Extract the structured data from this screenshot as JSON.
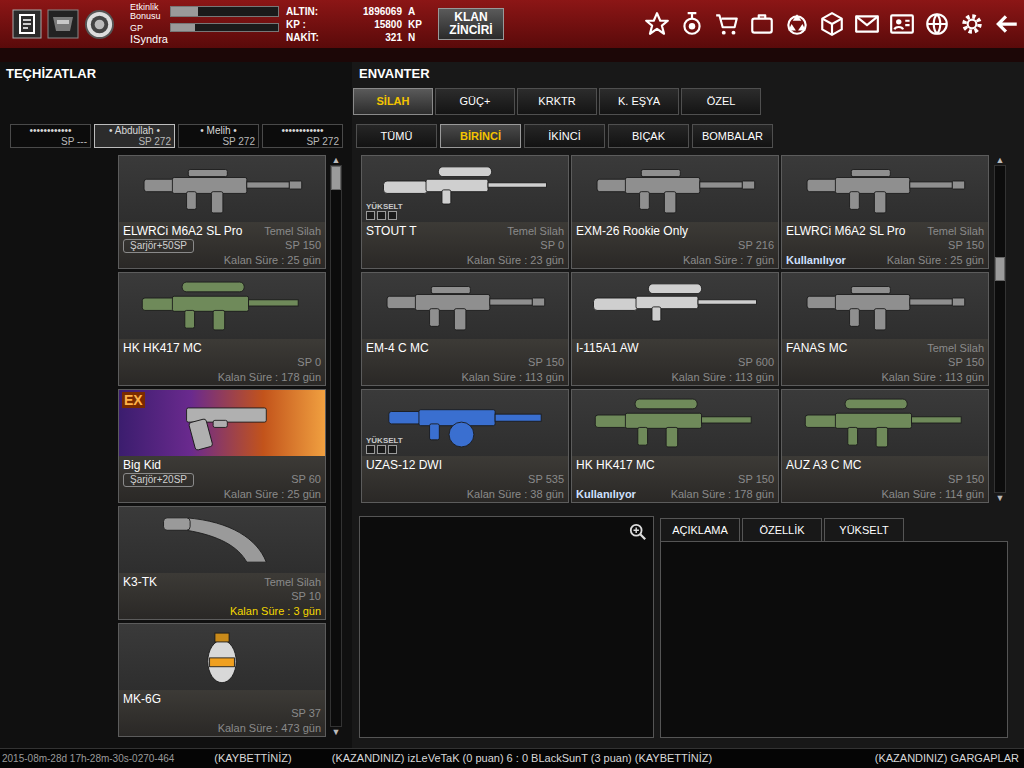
{
  "header": {
    "bonus_label": [
      "Etkinlik",
      "Bonusu"
    ],
    "bonus_level": 0.25,
    "gp_label": "GP",
    "gp_level": 0.22,
    "player": "ISyndra",
    "currencies": [
      {
        "label": "ALTIN:",
        "value": "1896069",
        "unit": "A"
      },
      {
        "label": "KP :",
        "value": "15800",
        "unit": "KP"
      },
      {
        "label": "NAKİT:",
        "value": "321",
        "unit": "N"
      }
    ],
    "clan_button": [
      "KLAN",
      "ZİNCİRİ"
    ]
  },
  "equipment": {
    "title": "TEÇHİZATLAR",
    "characters": [
      {
        "name": "••••••••••••",
        "sp": "SP ---",
        "selected": false
      },
      {
        "name": "• Abdullah •",
        "sp": "SP 272",
        "selected": true
      },
      {
        "name": "• Melih •",
        "sp": "SP 272",
        "selected": false
      },
      {
        "name": "••••••••••••",
        "sp": "SP 272",
        "selected": false
      }
    ],
    "items": [
      {
        "kind": "rifle",
        "name": "ELWRCi M6A2 SL Pro",
        "class": "Temel Silah",
        "addon": "Şarjör+50SP",
        "sp": "SP 150",
        "remaining": "Kalan Süre : 25 gün",
        "expiring": false
      },
      {
        "kind": "marksman",
        "name": "HK HK417 MC",
        "sp": "SP 0",
        "remaining": "Kalan Süre : 178 gün",
        "expiring": false
      },
      {
        "kind": "pistol",
        "name": "Big Kid",
        "badge": "EX",
        "addon": "Şarjör+20SP",
        "sp": "SP 60",
        "remaining": "Kalan Süre : 25 gün",
        "expiring": false
      },
      {
        "kind": "knife",
        "name": "K3-TK",
        "class": "Temel Silah",
        "sp": "SP 10",
        "remaining": "Kalan Süre : 3 gün",
        "expiring": true
      },
      {
        "kind": "grenade",
        "name": "MK-6G",
        "sp": "SP 37",
        "remaining": "Kalan Süre : 473 gün",
        "expiring": false
      }
    ],
    "scrollbar": {
      "up": "▲",
      "down": "▼",
      "position": 0
    }
  },
  "inventory": {
    "title": "ENVANTER",
    "categories": [
      {
        "label": "SİLAH",
        "selected": true
      },
      {
        "label": "GÜÇ+",
        "selected": false
      },
      {
        "label": "KRKTR",
        "selected": false
      },
      {
        "label": "K. EŞYA",
        "selected": false
      },
      {
        "label": "ÖZEL",
        "selected": false
      }
    ],
    "subcategories": [
      {
        "label": "TÜMÜ",
        "selected": false
      },
      {
        "label": "BİRİNCİ",
        "selected": true
      },
      {
        "label": "İKİNCİ",
        "selected": false
      },
      {
        "label": "BIÇAK",
        "selected": false
      },
      {
        "label": "BOMBALAR",
        "selected": false
      }
    ],
    "items": [
      {
        "kind": "sniper",
        "name": "STOUT T",
        "class": "Temel Silah",
        "sp": "SP 0",
        "remaining": "Kalan Süre : 23 gün",
        "expiring": false,
        "upgrade": {
          "label": "YÜKSELT",
          "slots": [
            false,
            false,
            false
          ]
        }
      },
      {
        "kind": "rifle",
        "name": "EXM-26 Rookie Only",
        "sp": "SP 216",
        "remaining": "Kalan Süre : 7 gün",
        "expiring": false
      },
      {
        "kind": "rifle",
        "name": "ELWRCi M6A2 SL Pro",
        "class": "Temel Silah",
        "sp": "SP 150",
        "remaining": "Kalan Süre : 25 gün",
        "expiring": false,
        "status": "Kullanılıyor"
      },
      {
        "kind": "rifle",
        "name": "EM-4 C MC",
        "sp": "SP 150",
        "remaining": "Kalan Süre : 113 gün",
        "expiring": false
      },
      {
        "kind": "sniper",
        "name": "I-115A1 AW",
        "sp": "SP 600",
        "remaining": "Kalan Süre : 113 gün",
        "expiring": false
      },
      {
        "kind": "rifle",
        "name": "FANAS MC",
        "class": "Temel Silah",
        "sp": "SP 150",
        "remaining": "Kalan Süre : 113 gün",
        "expiring": false
      },
      {
        "kind": "shotgun",
        "name": "UZAS-12 DWI",
        "sp": "SP 535",
        "remaining": "Kalan Süre : 38 gün",
        "expiring": false,
        "upgrade": {
          "label": "YÜKSELT",
          "slots": [
            false,
            false,
            false
          ]
        }
      },
      {
        "kind": "marksman",
        "name": "HK HK417 MC",
        "sp": "SP 150",
        "remaining": "Kalan Süre : 178 gün",
        "expiring": false,
        "status": "Kullanılıyor"
      },
      {
        "kind": "marksman",
        "name": "AUZ A3 C MC",
        "sp": "SP 150",
        "remaining": "Kalan Süre : 114 gün",
        "expiring": false
      }
    ],
    "scrollbar": {
      "up": "▲",
      "down": "▼",
      "position": 0.3
    }
  },
  "details": {
    "tabs": [
      {
        "label": "AÇIKLAMA",
        "selected": false
      },
      {
        "label": "ÖZELLİK",
        "selected": false
      },
      {
        "label": "YÜKSELT",
        "selected": false
      }
    ]
  },
  "ticker": {
    "timestamp": "2015-08m-28d 17h-28m-30s-0270-464",
    "items": [
      "(KAYBETTİNİZ)",
      "(KAZANDINIZ) izLeVeTaK (0 puan) 6 : 0 BLackSunT (3 puan) (KAYBETTİNİZ)",
      "(KAZANDINIZ) GARGAPLAR"
    ]
  }
}
